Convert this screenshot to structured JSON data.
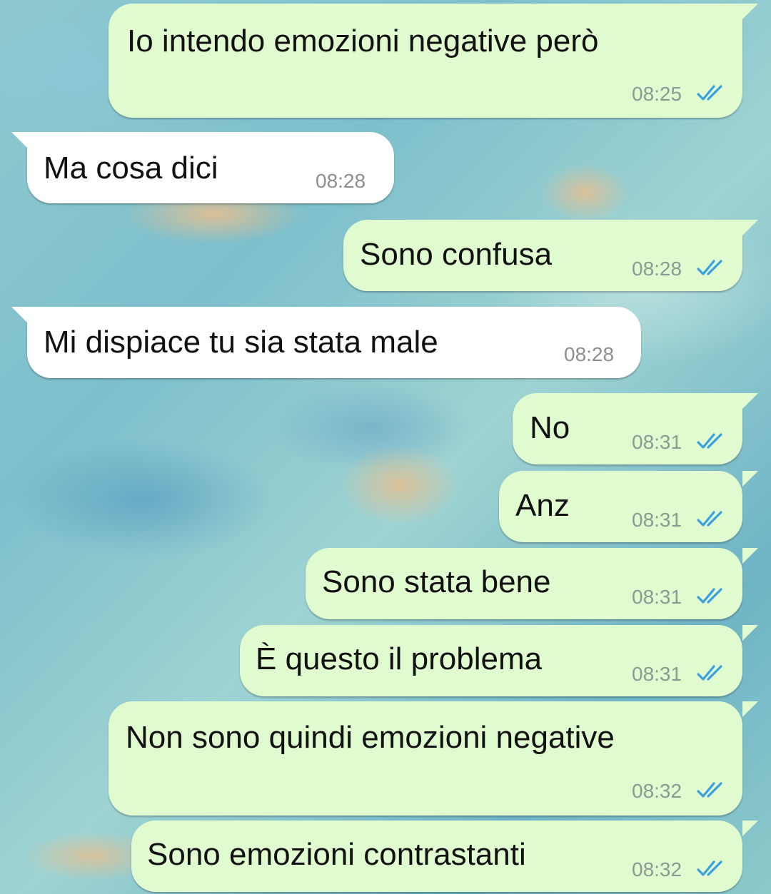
{
  "colors": {
    "outgoing_bubble": "#e1fbd0",
    "incoming_bubble": "#ffffff",
    "read_ticks": "#3aa1e0"
  },
  "messages": [
    {
      "direction": "outgoing",
      "text": "Io intendo emozioni negative però",
      "time": "08:25",
      "status": "read",
      "status_icon": "double-check-icon"
    },
    {
      "direction": "incoming",
      "text": "Ma cosa dici",
      "time": "08:28"
    },
    {
      "direction": "outgoing",
      "text": "Sono confusa",
      "time": "08:28",
      "status": "read",
      "status_icon": "double-check-icon"
    },
    {
      "direction": "incoming",
      "text": "Mi dispiace tu sia stata male",
      "time": "08:28"
    },
    {
      "direction": "outgoing",
      "text": "No",
      "time": "08:31",
      "status": "read",
      "status_icon": "double-check-icon"
    },
    {
      "direction": "outgoing",
      "text": "Anz",
      "time": "08:31",
      "status": "read",
      "status_icon": "double-check-icon"
    },
    {
      "direction": "outgoing",
      "text": "Sono stata bene",
      "time": "08:31",
      "status": "read",
      "status_icon": "double-check-icon"
    },
    {
      "direction": "outgoing",
      "text": "È questo il problema",
      "time": "08:31",
      "status": "read",
      "status_icon": "double-check-icon"
    },
    {
      "direction": "outgoing",
      "text": "Non sono quindi emozioni negative",
      "time": "08:32",
      "status": "read",
      "status_icon": "double-check-icon"
    },
    {
      "direction": "outgoing",
      "text": "Sono emozioni contrastanti",
      "time": "08:32",
      "status": "read",
      "status_icon": "double-check-icon"
    }
  ]
}
